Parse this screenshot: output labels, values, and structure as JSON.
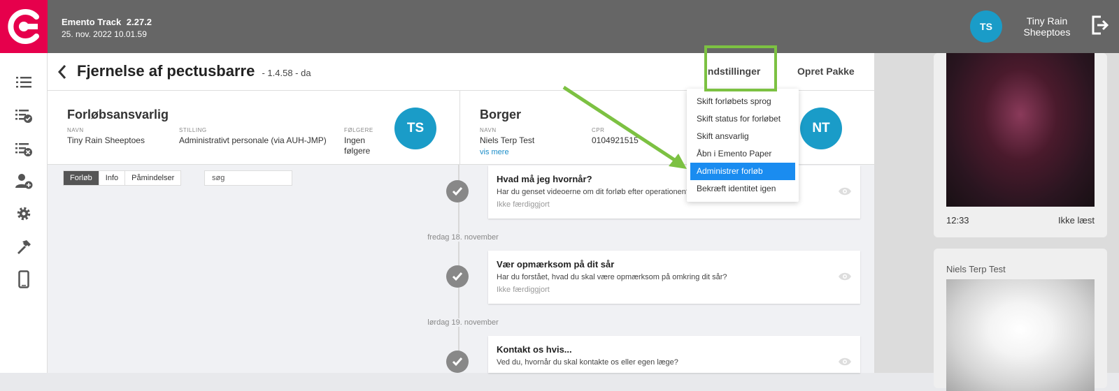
{
  "app": {
    "name": "Emento Track",
    "version": "2.27.2",
    "datetime": "25. nov. 2022 10.01.59"
  },
  "user": {
    "initials": "TS",
    "name": "Tiny Rain Sheeptoes"
  },
  "header": {
    "title": "Fjernelse af pectusbarre",
    "subtitle": "- 1.4.58 - da",
    "settings_label": "Indstillinger",
    "create_label": "Opret Pakke"
  },
  "responsible": {
    "section_title": "Forløbsansvarlig",
    "name_label": "NAVN",
    "name": "Tiny Rain Sheeptoes",
    "position_label": "STILLING",
    "position": "Administrativt personale (via AUH-JMP)",
    "followers_label": "FØLGERE",
    "followers": "Ingen følgere",
    "initials": "TS"
  },
  "citizen": {
    "section_title": "Borger",
    "name_label": "NAVN",
    "name": "Niels Terp Test",
    "more_link": "vis mere",
    "cpr_label": "CPR",
    "cpr": "0104921515",
    "initials": "NT"
  },
  "tabs": [
    "Forløb",
    "Info",
    "Påmindelser"
  ],
  "search": {
    "placeholder": "søg"
  },
  "timeline": {
    "items": [
      {
        "title": "Hvad må jeg hvornår?",
        "text": "Har du genset videoerne om dit forløb efter operationen?",
        "status": "Ikke færdiggjort"
      },
      {
        "date": "fredag 18. november",
        "title": "Vær opmærksom på dit sår",
        "text": "Har du forstået, hvad du skal være opmærksom på omkring dit sår?",
        "status": "Ikke færdiggjort"
      },
      {
        "date": "lørdag 19. november",
        "title": "Kontakt os hvis...",
        "text": "Ved du, hvornår du skal kontakte os eller egen læge?"
      }
    ]
  },
  "dropdown": {
    "items": [
      "Skift forløbets sprog",
      "Skift status for forløbet",
      "Skift ansvarlig",
      "Åbn i Emento Paper",
      "Administrer forløb",
      "Bekræft identitet igen"
    ],
    "active_index": 4
  },
  "sidebar_messages": [
    {
      "time": "12:33",
      "status": "Ikke læst"
    },
    {
      "sender": "Niels Terp Test"
    }
  ],
  "colors": {
    "brand": "#e6004c",
    "accent": "#1a9cc8",
    "highlight": "#7cc142",
    "selection": "#1a8cf0"
  }
}
